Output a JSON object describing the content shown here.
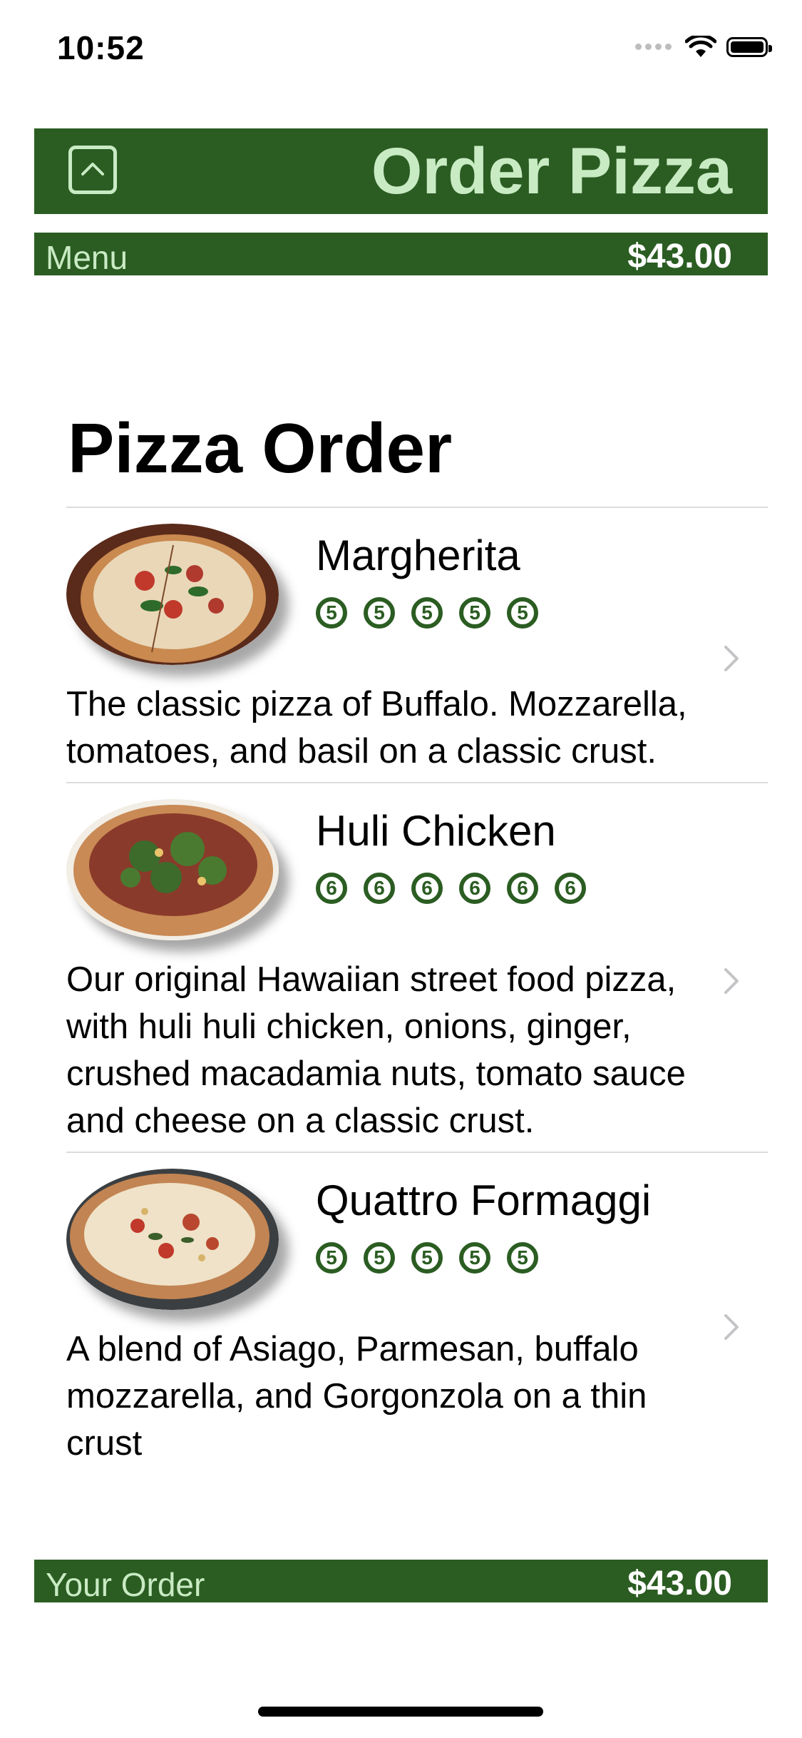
{
  "status_bar": {
    "time": "10:52"
  },
  "header": {
    "title": "Order Pizza"
  },
  "subbar": {
    "label": "Menu",
    "total": "$43.00"
  },
  "list": {
    "title": "Pizza Order",
    "items": [
      {
        "name": "Margherita",
        "ratings": [
          "5",
          "5",
          "5",
          "5",
          "5"
        ],
        "description": "The classic pizza of Buffalo. Mozzarella, tomatoes, and basil on a classic crust."
      },
      {
        "name": "Huli Chicken",
        "ratings": [
          "6",
          "6",
          "6",
          "6",
          "6",
          "6"
        ],
        "description": "Our original Hawaiian street food pizza, with huli huli chicken, onions, ginger, crushed macadamia nuts, tomato sauce and cheese on a classic crust."
      },
      {
        "name": "Quattro Formaggi",
        "ratings": [
          "5",
          "5",
          "5",
          "5",
          "5"
        ],
        "description": "A blend of Asiago, Parmesan, buffalo mozzarella, and Gorgonzola on a thin crust"
      }
    ]
  },
  "footer": {
    "label": "Your Order",
    "total": "$43.00"
  },
  "colors": {
    "accent": "#2b5d22",
    "accent_text": "#c9ebc4"
  },
  "icons": {
    "header": "chevron-up-square-icon",
    "row": "chevron-right-icon"
  }
}
